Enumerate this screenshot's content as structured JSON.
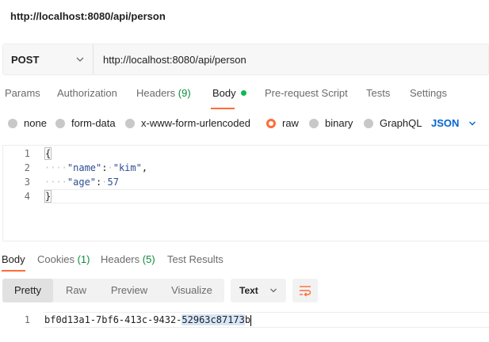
{
  "window": {
    "title": "http://localhost:8080/api/person"
  },
  "request": {
    "method": "POST",
    "url": "http://localhost:8080/api/person"
  },
  "request_tabs": {
    "params": "Params",
    "authorization": "Authorization",
    "headers": "Headers",
    "headers_count": "(9)",
    "body": "Body",
    "prerequest": "Pre-request Script",
    "tests": "Tests",
    "settings": "Settings"
  },
  "body_types": {
    "none": "none",
    "form_data": "form-data",
    "urlencoded": "x-www-form-urlencoded",
    "raw": "raw",
    "binary": "binary",
    "graphql": "GraphQL",
    "selected": "raw",
    "format": "JSON"
  },
  "editor": {
    "lines": [
      {
        "num": "1",
        "text": "{"
      },
      {
        "num": "2",
        "key": "\"name\"",
        "value": "\"kim\"",
        "comma": ","
      },
      {
        "num": "3",
        "key": "\"age\"",
        "value": "57",
        "comma": ""
      },
      {
        "num": "4",
        "text": "}"
      }
    ]
  },
  "response_tabs": {
    "body": "Body",
    "cookies": "Cookies",
    "cookies_count": "(1)",
    "headers": "Headers",
    "headers_count": "(5)",
    "test_results": "Test Results"
  },
  "response_view": {
    "pretty": "Pretty",
    "raw": "Raw",
    "preview": "Preview",
    "visualize": "Visualize",
    "format": "Text"
  },
  "response_body": {
    "line_num": "1",
    "text_plain": "bf0d13a1-7bf6-413c-9432-",
    "text_selected": "52963c87173",
    "text_after": "b"
  },
  "colors": {
    "accent": "#ff6c37",
    "link_blue": "#0265d2",
    "count_green": "#0d8a3c",
    "status_dot": "#0cbb52"
  }
}
